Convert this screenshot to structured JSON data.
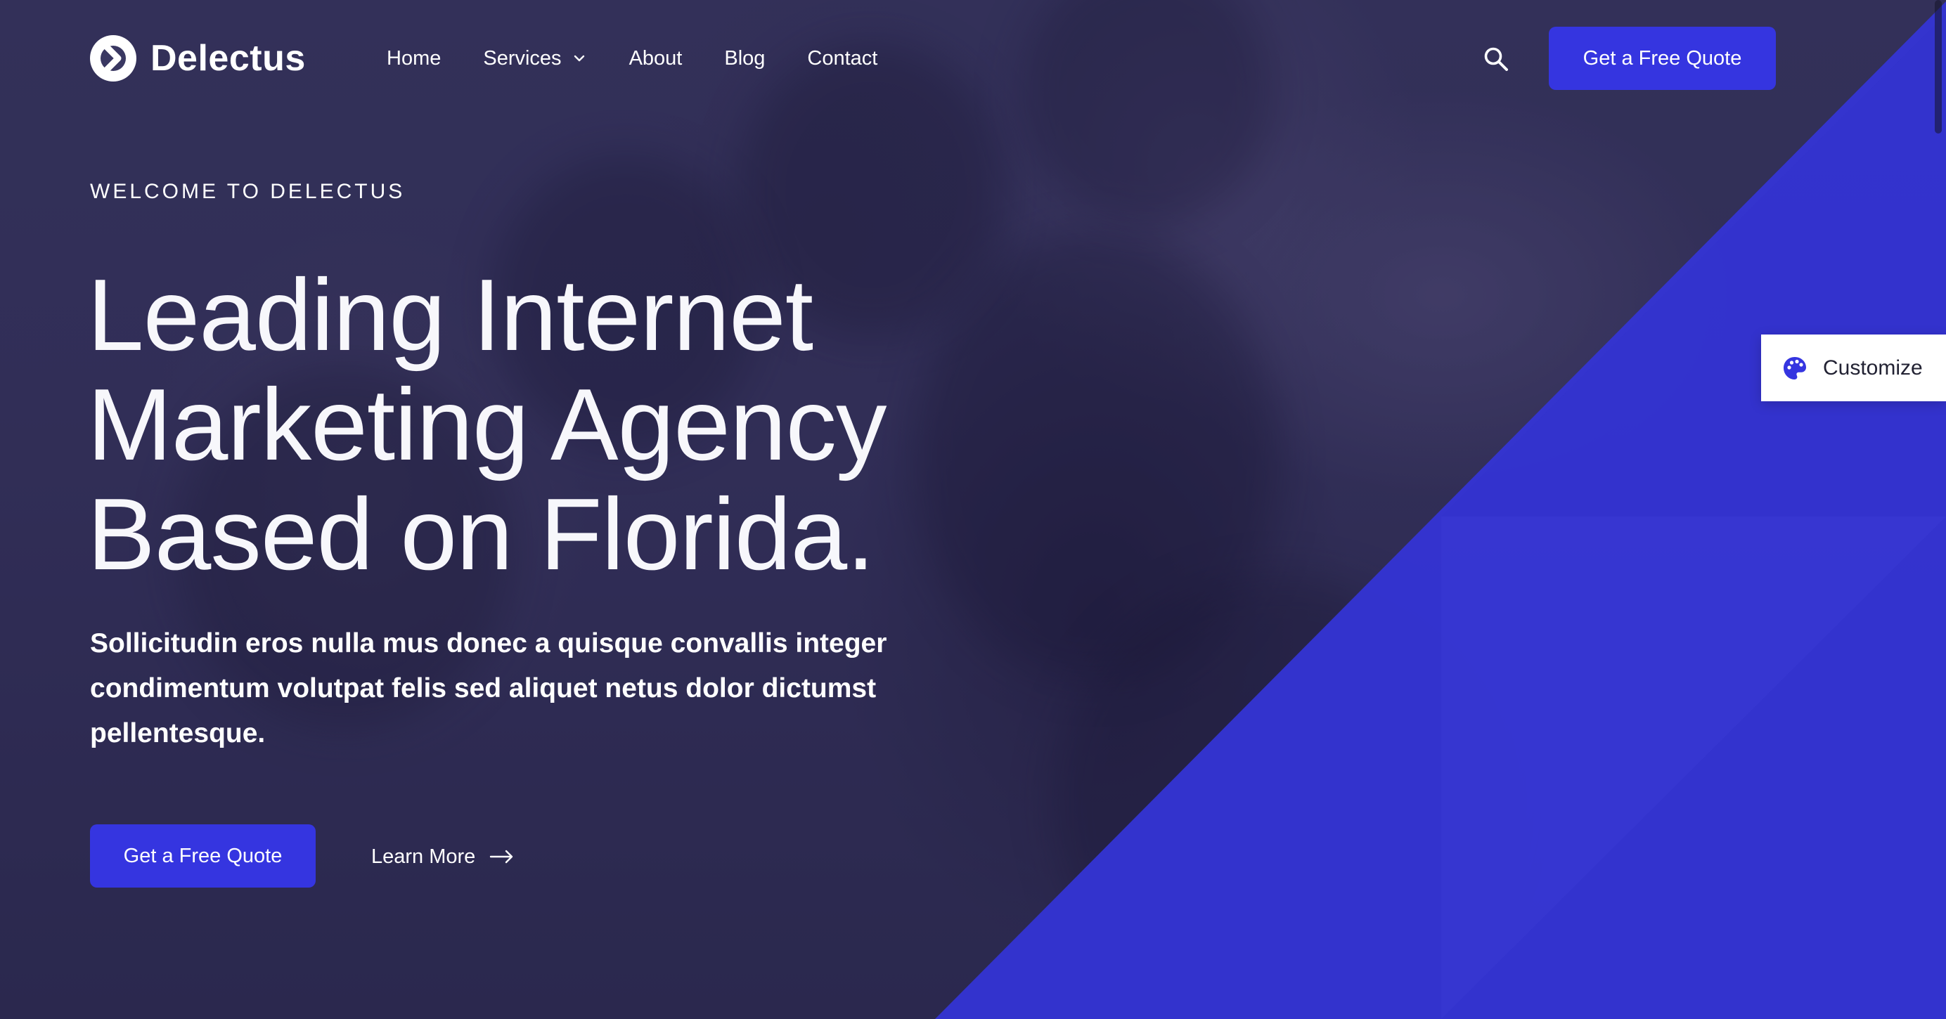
{
  "brand": {
    "name": "Delectus",
    "accent": "#3535e0"
  },
  "nav": {
    "items": [
      {
        "label": "Home"
      },
      {
        "label": "Services",
        "has_dropdown": true
      },
      {
        "label": "About"
      },
      {
        "label": "Blog"
      },
      {
        "label": "Contact"
      }
    ],
    "cta_label": "Get a Free Quote"
  },
  "hero": {
    "eyebrow": "WELCOME TO DELECTUS",
    "headline_lines": [
      "Leading Internet",
      "Marketing Agency",
      "Based on Florida."
    ],
    "lede": "Sollicitudin eros nulla mus donec a quisque convallis integer condimentum volutpat felis sed aliquet netus dolor dictumst pellentesque.",
    "primary_cta": "Get a Free Quote",
    "secondary_cta": "Learn More"
  },
  "customize": {
    "label": "Customize"
  },
  "icons": {
    "logo": "delectus-logo-icon",
    "dropdown": "chevron-down-icon",
    "search": "search-icon",
    "arrow": "arrow-right-icon",
    "palette": "palette-icon"
  }
}
